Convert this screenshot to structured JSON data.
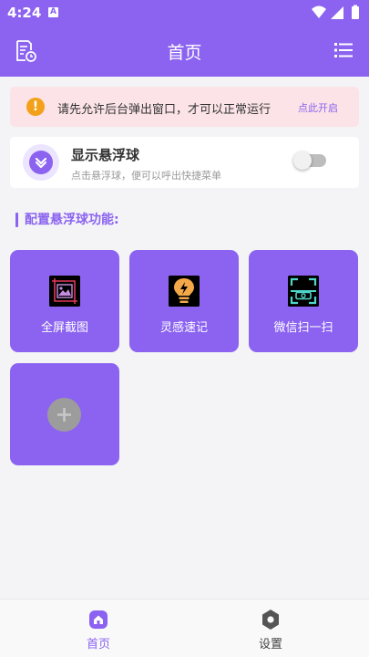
{
  "status_bar": {
    "time": "4:24",
    "notification_badge": "A"
  },
  "header": {
    "title": "首页",
    "left_icon": "document-clock-icon",
    "right_icon": "list-menu-icon"
  },
  "notice": {
    "icon": "warning-icon",
    "icon_glyph": "!",
    "text": "请先允许后台弹出窗口，才可以正常运行",
    "action": "点此开启"
  },
  "float_ball": {
    "title": "显示悬浮球",
    "subtitle": "点击悬浮球，便可以呼出快捷菜单",
    "enabled": false
  },
  "section": {
    "title": "配置悬浮球功能:"
  },
  "tiles": [
    {
      "label": "全屏截图",
      "icon": "screenshot-icon"
    },
    {
      "label": "灵感速记",
      "icon": "lightbulb-icon"
    },
    {
      "label": "微信扫一扫",
      "icon": "scan-icon"
    },
    {
      "label": "",
      "icon": "add-icon"
    }
  ],
  "bottom_nav": [
    {
      "label": "首页",
      "icon": "home-icon",
      "active": true
    },
    {
      "label": "设置",
      "icon": "settings-icon",
      "active": false
    }
  ],
  "colors": {
    "primary": "#8b63f0",
    "notice_bg": "#fbe3e7",
    "warning": "#f3a11a",
    "page_bg": "#f4f4f6"
  }
}
